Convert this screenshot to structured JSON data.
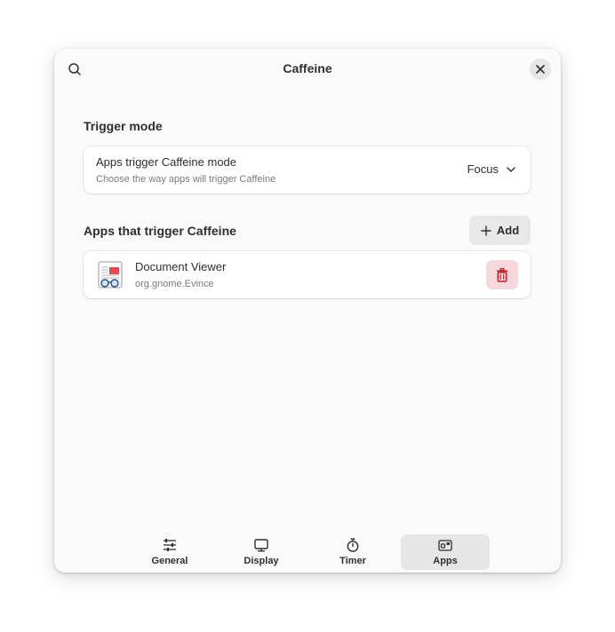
{
  "window": {
    "title": "Caffeine"
  },
  "trigger_mode": {
    "section_title": "Trigger mode",
    "row_title": "Apps trigger Caffeine mode",
    "row_subtitle": "Choose the way apps will trigger Caffeine",
    "selected_value": "Focus"
  },
  "apps": {
    "section_title": "Apps that trigger Caffeine",
    "add_label": "Add",
    "items": [
      {
        "name": "Document Viewer",
        "app_id": "org.gnome.Evince",
        "icon": "document-viewer-icon"
      }
    ]
  },
  "tabs": [
    {
      "label": "General",
      "icon": "sliders-icon",
      "active": false
    },
    {
      "label": "Display",
      "icon": "monitor-icon",
      "active": false
    },
    {
      "label": "Timer",
      "icon": "stopwatch-icon",
      "active": false
    },
    {
      "label": "Apps",
      "icon": "apps-icon",
      "active": true
    }
  ],
  "colors": {
    "destructive": "#c01c28",
    "destructive_bg": "#f7d6dc",
    "window_bg": "#fafafa"
  }
}
